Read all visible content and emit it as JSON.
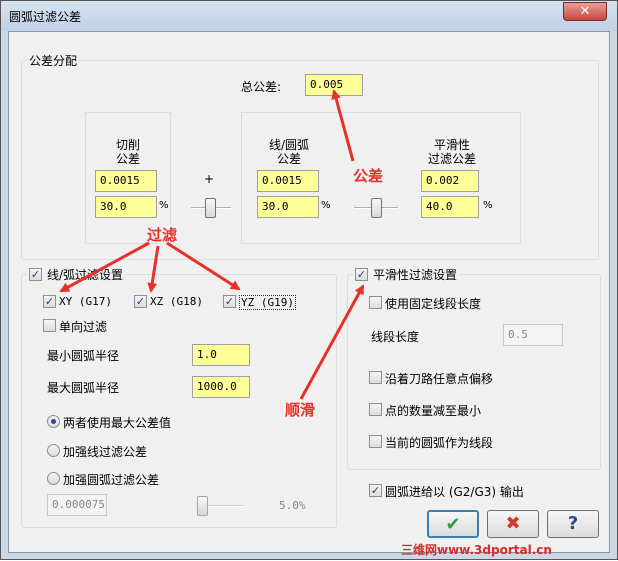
{
  "window": {
    "title": "圆弧过滤公差",
    "close_glyph": "✕"
  },
  "tolerance_allocation": {
    "group_label": "公差分配",
    "total_label": "总公差:",
    "total_value": "0.005",
    "cut": {
      "label_line1": "切削",
      "label_line2": "公差",
      "value": "0.0015",
      "percent": "30.0",
      "percent_sign": "%"
    },
    "plus_sign": "+",
    "line_arc": {
      "label_line1": "线/圆弧",
      "label_line2": "公差",
      "value": "0.0015",
      "percent": "30.0",
      "percent_sign": "%"
    },
    "smooth": {
      "label_line1": "平滑性",
      "label_line2": "过滤公差",
      "value": "0.002",
      "percent": "40.0",
      "percent_sign": "%"
    }
  },
  "line_arc_filter": {
    "label": "线/弧过滤设置",
    "checked": true,
    "xy": {
      "label": "XY (G17)",
      "checked": true
    },
    "xz": {
      "label": "XZ (G18)",
      "checked": true
    },
    "yz": {
      "label": "YZ (G19)",
      "checked": true
    },
    "one_way": {
      "label": "单向过滤",
      "checked": false
    },
    "min_radius_label": "最小圆弧半径",
    "min_radius_value": "1.0",
    "max_radius_label": "最大圆弧半径",
    "max_radius_value": "1000.0",
    "radios": [
      {
        "label": "两者使用最大公差值",
        "selected": true
      },
      {
        "label": "加强线过滤公差",
        "selected": false
      },
      {
        "label": "加强圆弧过滤公差",
        "selected": false
      }
    ],
    "bias_value": "0.000075",
    "bias_percent": "5.0%"
  },
  "smooth_filter": {
    "label": "平滑性过滤设置",
    "checked": true,
    "fixed_segment": {
      "label": "使用固定线段长度",
      "checked": false
    },
    "segment_length_label": "线段长度",
    "segment_length_value": "0.5",
    "along_path": {
      "label": "沿着刀路任意点偏移",
      "checked": false
    },
    "min_points": {
      "label": "点的数量减至最小",
      "checked": false
    },
    "arc_as_segment": {
      "label": "当前的圆弧作为线段",
      "checked": false
    }
  },
  "arc_output": {
    "label": "圆弧进给以 (G2/G3) 输出",
    "checked": true
  },
  "buttons": {
    "ok": "✔",
    "cancel": "✖",
    "help": "?"
  },
  "annotations": {
    "tolerance": "公差",
    "filter": "过滤",
    "smooth": "顺滑"
  },
  "watermark": "三维网www.3dportal.cn",
  "colors": {
    "input_bg": "#ffff99",
    "annotation": "#e8302a",
    "ok_check": "#2ea043",
    "cancel_x": "#d03a2a",
    "help_q": "#2c4f8c"
  }
}
